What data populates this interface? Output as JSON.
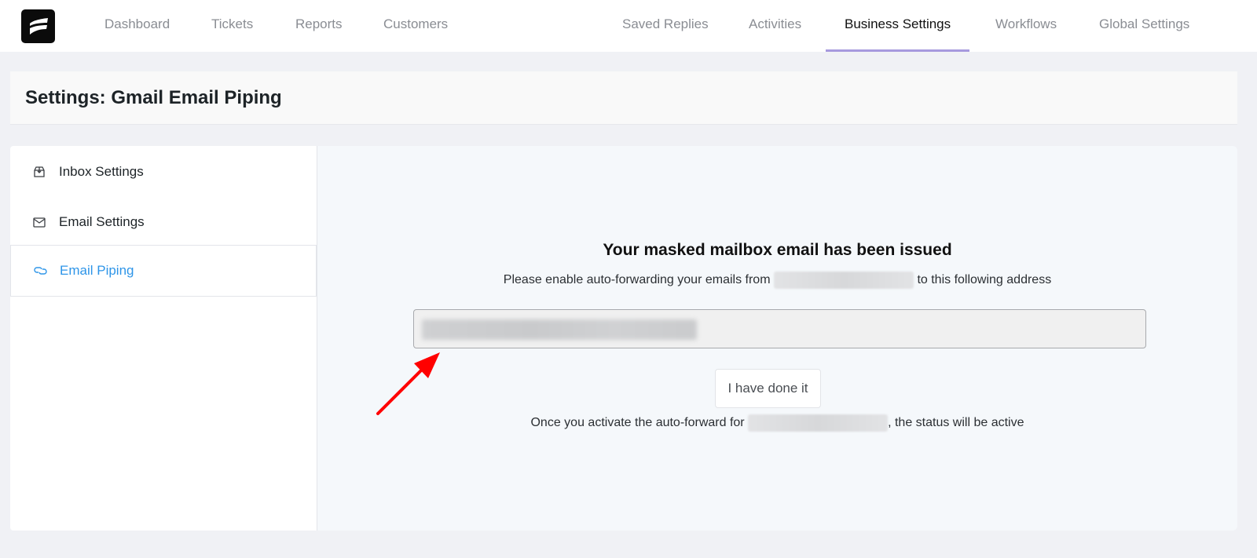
{
  "topnav": {
    "logo_icon": "brand-logo-icon",
    "left_items": [
      {
        "label": "Dashboard"
      },
      {
        "label": "Tickets"
      },
      {
        "label": "Reports"
      },
      {
        "label": "Customers"
      }
    ],
    "right_items": [
      {
        "label": "Saved Replies"
      },
      {
        "label": "Activities"
      },
      {
        "label": "Business Settings",
        "active": true
      },
      {
        "label": "Workflows"
      },
      {
        "label": "Global Settings"
      }
    ],
    "active_color": "#a79ade"
  },
  "page": {
    "title": "Settings: Gmail Email Piping"
  },
  "sidebar": {
    "items": [
      {
        "label": "Inbox Settings",
        "icon": "inbox-box-icon"
      },
      {
        "label": "Email Settings",
        "icon": "envelope-icon"
      },
      {
        "label": "Email Piping",
        "icon": "link-icon",
        "active": true
      }
    ],
    "active_color": "#2e95e8"
  },
  "main": {
    "headline": "Your masked mailbox email has been issued",
    "instruction_prefix": "Please enable auto-forwarding your emails from",
    "instruction_suffix": "to this following address",
    "address_value": "[redacted]",
    "done_button": "I have done it",
    "status_prefix": "Once you activate the auto-forward for",
    "status_suffix": ", the status will be active"
  },
  "annotation": {
    "arrow_color": "#ff0000"
  }
}
